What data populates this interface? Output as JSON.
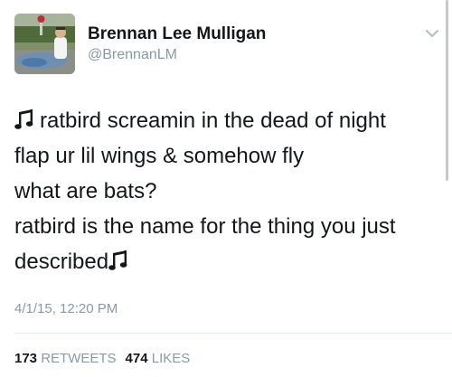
{
  "author": {
    "display_name": "Brennan Lee Mulligan",
    "handle": "@BrennanLM",
    "avatar_icon": "profile-photo",
    "menu_icon": "chevron-down-icon"
  },
  "tweet": {
    "lines": [
      "ratbird screamin in the dead of night",
      "flap ur lil wings & somehow fly",
      "what are bats?",
      "ratbird is the name for the thing you just",
      "described"
    ],
    "emoji_icon": "musical-note-icon",
    "timestamp": "4/1/15, 12:20 PM"
  },
  "stats": {
    "retweets_count": "173",
    "retweets_label": "RETWEETS",
    "likes_count": "474",
    "likes_label": "LIKES"
  },
  "colors": {
    "text": "#14171a",
    "muted": "#8899a6",
    "divider": "#e1e8ed"
  }
}
